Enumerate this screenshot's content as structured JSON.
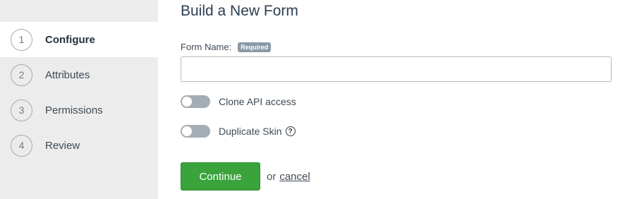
{
  "sidebar": {
    "steps": [
      {
        "number": "1",
        "label": "Configure"
      },
      {
        "number": "2",
        "label": "Attributes"
      },
      {
        "number": "3",
        "label": "Permissions"
      },
      {
        "number": "4",
        "label": "Review"
      }
    ]
  },
  "main": {
    "title": "Build a New Form",
    "form_name_label": "Form Name:",
    "required_badge": "Required",
    "form_name_value": "",
    "clone_api_label": "Clone API access",
    "duplicate_skin_label": "Duplicate Skin",
    "help_glyph": "?",
    "continue_label": "Continue",
    "or_text": "or",
    "cancel_label": "cancel"
  },
  "colors": {
    "sidebar_bg": "#ececec",
    "button_green": "#3aa33c",
    "toggle_off": "#a3adb5"
  }
}
